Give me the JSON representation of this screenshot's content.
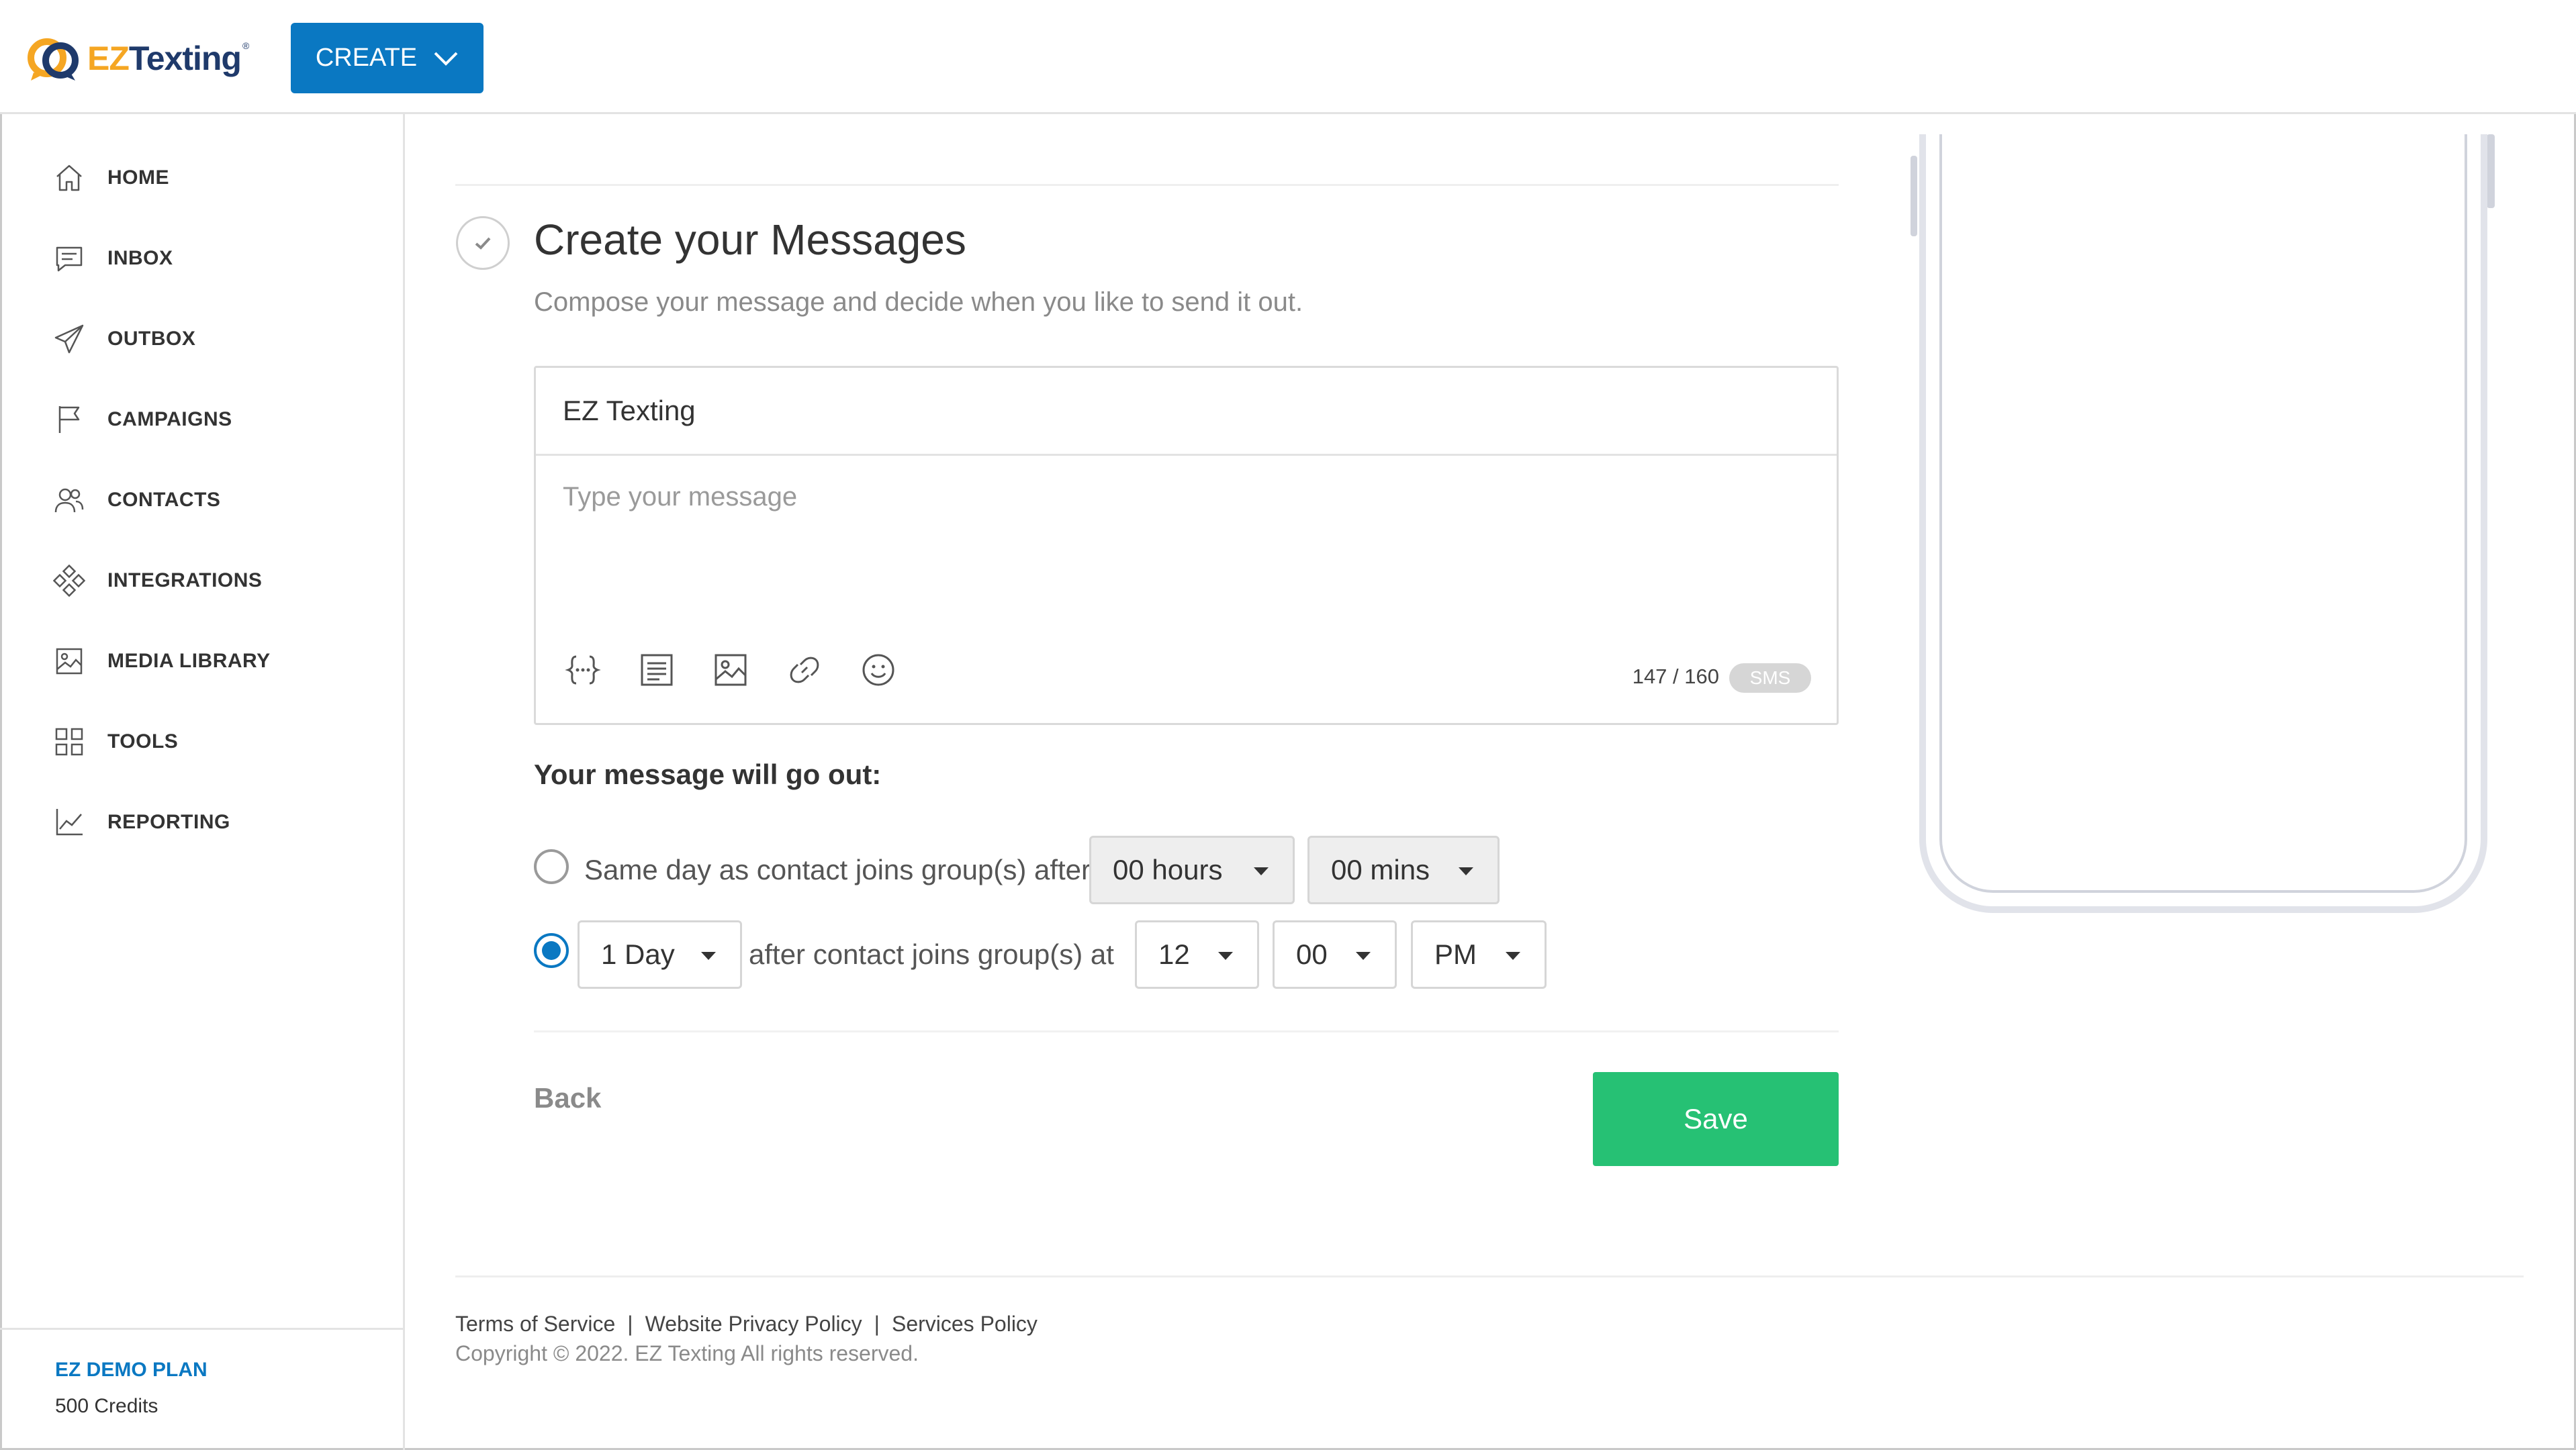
{
  "header": {
    "logo_ez": "EZ",
    "logo_texting": "Texting",
    "logo_reg": "®",
    "create_label": "CREATE"
  },
  "sidebar": {
    "items": [
      {
        "label": "HOME",
        "icon": "home-icon"
      },
      {
        "label": "INBOX",
        "icon": "inbox-icon"
      },
      {
        "label": "OUTBOX",
        "icon": "paper-plane-icon"
      },
      {
        "label": "CAMPAIGNS",
        "icon": "flag-icon"
      },
      {
        "label": "CONTACTS",
        "icon": "users-icon"
      },
      {
        "label": "INTEGRATIONS",
        "icon": "integrations-icon"
      },
      {
        "label": "MEDIA LIBRARY",
        "icon": "image-icon"
      },
      {
        "label": "TOOLS",
        "icon": "grid-icon"
      },
      {
        "label": "REPORTING",
        "icon": "chart-line-icon"
      }
    ],
    "plan_name": "EZ DEMO PLAN",
    "credits": "500 Credits"
  },
  "main": {
    "title": "Create your Messages",
    "subtitle": "Compose your message and decide when you like to send it out.",
    "composer": {
      "sender": "EZ Texting",
      "placeholder": "Type your message",
      "tools": [
        "merge-fields-icon",
        "template-icon",
        "image-icon",
        "link-icon",
        "emoji-icon"
      ],
      "counter": "147 / 160",
      "badge": "SMS"
    },
    "schedule": {
      "heading": "Your message will go out:",
      "option1": {
        "text": "Same day as contact joins group(s) after",
        "hours": "00 hours",
        "mins": "00 mins",
        "selected": false
      },
      "option2": {
        "day": "1 Day",
        "text": "after contact joins group(s) at",
        "hour": "12",
        "minute": "00",
        "ampm": "PM",
        "selected": true
      }
    },
    "back_label": "Back",
    "save_label": "Save"
  },
  "footer": {
    "links": [
      "Terms of Service",
      "Website Privacy Policy",
      "Services Policy"
    ],
    "separator": "|",
    "copyright": "Copyright © 2022. EZ Texting All rights reserved."
  },
  "colors": {
    "brand_blue": "#0a78c2",
    "save_green": "#26c174",
    "logo_orange": "#f5a623",
    "logo_navy": "#1f3a6b"
  }
}
